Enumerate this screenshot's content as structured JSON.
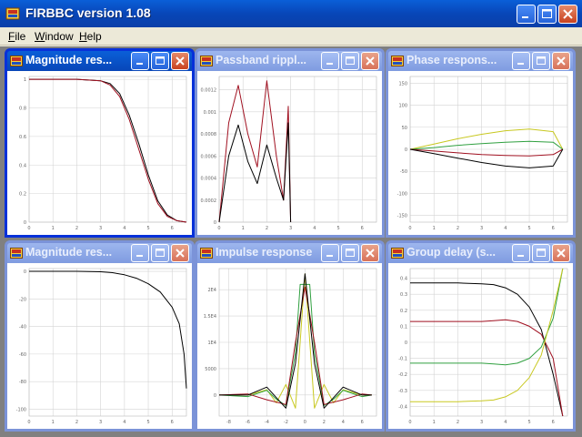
{
  "window": {
    "title": "FIRBBC version 1.08"
  },
  "menu": [
    {
      "label": "File"
    },
    {
      "label": "Window"
    },
    {
      "label": "Help"
    }
  ],
  "colors": {
    "active_title": "#0a3fa8",
    "inactive_title": "#7f9be0",
    "series": [
      "#000000",
      "#a01020",
      "#30a040",
      "#c8c820"
    ]
  },
  "children": [
    {
      "title": "Magnitude res...",
      "active": true
    },
    {
      "title": "Passband rippl...",
      "active": false
    },
    {
      "title": "Phase respons...",
      "active": false
    },
    {
      "title": "Magnitude res...",
      "active": false
    },
    {
      "title": "Impulse response",
      "active": false
    },
    {
      "title": "Group delay (s...",
      "active": false
    }
  ],
  "chart_data": [
    {
      "type": "line",
      "x_ticks": [
        "0",
        "1",
        "2",
        "3",
        "4",
        "5",
        "6"
      ],
      "y_ticks": [
        "0",
        "0.2",
        "0.4",
        "0.6",
        "0.8",
        "1"
      ],
      "xlim": [
        0,
        6.6
      ],
      "ylim": [
        0,
        1.02
      ],
      "series": [
        {
          "color": "#000000",
          "x": [
            0,
            1,
            2,
            3,
            3.4,
            3.8,
            4.2,
            4.6,
            5.0,
            5.4,
            5.8,
            6.2,
            6.6
          ],
          "y": [
            1,
            1,
            1,
            0.99,
            0.97,
            0.9,
            0.75,
            0.55,
            0.33,
            0.15,
            0.05,
            0.01,
            0
          ]
        },
        {
          "color": "#a01020",
          "x": [
            0,
            1,
            2,
            3,
            3.4,
            3.8,
            4.2,
            4.6,
            5.0,
            5.4,
            5.8,
            6.2,
            6.6
          ],
          "y": [
            1,
            1,
            1,
            0.99,
            0.96,
            0.88,
            0.72,
            0.51,
            0.3,
            0.13,
            0.04,
            0.01,
            0
          ]
        }
      ]
    },
    {
      "type": "line",
      "x_ticks": [
        "0",
        "1",
        "2",
        "3",
        "4",
        "5",
        "6"
      ],
      "y_ticks": [
        "0",
        "0.0002",
        "0.0004",
        "0.0006",
        "0.0008",
        "0.001",
        "0.0012"
      ],
      "xlim": [
        0,
        6.6
      ],
      "ylim": [
        0,
        0.00132
      ],
      "series": [
        {
          "color": "#a01020",
          "x": [
            0,
            0.4,
            0.8,
            1.2,
            1.6,
            2.0,
            2.4,
            2.7,
            2.9,
            3.0
          ],
          "y": [
            0,
            0.0009,
            0.00124,
            0.0008,
            0.0005,
            0.00128,
            0.0006,
            0.0002,
            0.00105,
            0
          ]
        },
        {
          "color": "#000000",
          "x": [
            0,
            0.4,
            0.8,
            1.2,
            1.6,
            2.0,
            2.4,
            2.7,
            2.9,
            3.0
          ],
          "y": [
            0,
            0.0006,
            0.00088,
            0.00055,
            0.00035,
            0.0007,
            0.0004,
            0.0002,
            0.0009,
            0
          ]
        }
      ]
    },
    {
      "type": "line",
      "x_ticks": [
        "0",
        "1",
        "2",
        "3",
        "4",
        "5",
        "6"
      ],
      "y_ticks": [
        "-150",
        "-100",
        "-50",
        "0",
        "50",
        "100",
        "150"
      ],
      "xlim": [
        0,
        6.6
      ],
      "ylim": [
        -165,
        165
      ],
      "series": [
        {
          "color": "#c8c820",
          "x": [
            0,
            1,
            2,
            3,
            4,
            5,
            6,
            6.4
          ],
          "y": [
            0,
            12,
            24,
            34,
            42,
            46,
            40,
            0
          ]
        },
        {
          "color": "#30a040",
          "x": [
            0,
            1,
            2,
            3,
            4,
            5,
            6,
            6.4
          ],
          "y": [
            0,
            4,
            9,
            13,
            16,
            18,
            16,
            0
          ]
        },
        {
          "color": "#a01020",
          "x": [
            0,
            1,
            2,
            3,
            4,
            5,
            6,
            6.4
          ],
          "y": [
            0,
            -4,
            -8,
            -12,
            -14,
            -15,
            -12,
            0
          ]
        },
        {
          "color": "#000000",
          "x": [
            0,
            1,
            2,
            3,
            4,
            5,
            6,
            6.4
          ],
          "y": [
            0,
            -10,
            -20,
            -30,
            -38,
            -42,
            -38,
            0
          ]
        }
      ]
    },
    {
      "type": "line",
      "x_ticks": [
        "0",
        "1",
        "2",
        "3",
        "4",
        "5",
        "6"
      ],
      "y_ticks": [
        "-100",
        "-80",
        "-60",
        "-40",
        "-20",
        "0"
      ],
      "xlim": [
        0,
        6.6
      ],
      "ylim": [
        -105,
        2
      ],
      "series": [
        {
          "color": "#000000",
          "x": [
            0,
            1,
            2,
            3,
            3.5,
            4,
            4.5,
            5,
            5.5,
            6,
            6.3,
            6.5,
            6.6
          ],
          "y": [
            0,
            0,
            0,
            -0.3,
            -1,
            -2.5,
            -5,
            -9,
            -15,
            -26,
            -38,
            -60,
            -85
          ]
        }
      ]
    },
    {
      "type": "line",
      "x_ticks": [
        "-8",
        "-6",
        "-4",
        "-2",
        "0",
        "2",
        "4",
        "6"
      ],
      "y_ticks": [
        "0",
        "5000",
        "1E4",
        "1.5E4",
        "2E4"
      ],
      "xlim": [
        -9,
        7.5
      ],
      "ylim": [
        -4000,
        24000
      ],
      "series": [
        {
          "color": "#c8c820",
          "x": [
            -9,
            -6,
            -4,
            -3,
            -2,
            -1,
            0,
            1,
            2,
            3,
            4,
            6,
            7
          ],
          "y": [
            0,
            0,
            1000,
            -1500,
            2000,
            -2500,
            23000,
            -2500,
            2000,
            -1500,
            1000,
            0,
            0
          ]
        },
        {
          "color": "#30a040",
          "x": [
            -9,
            -6,
            -4,
            -3,
            -2,
            -1,
            -0.5,
            0.5,
            1,
            2,
            3,
            4,
            6,
            7
          ],
          "y": [
            0,
            -300,
            900,
            -800,
            -2000,
            8000,
            21000,
            21000,
            8000,
            -2000,
            -800,
            900,
            -300,
            0
          ]
        },
        {
          "color": "#a01020",
          "x": [
            -9,
            -6,
            -4,
            -2,
            -1,
            0,
            1,
            2,
            4,
            6,
            7
          ],
          "y": [
            0,
            200,
            -900,
            -1800,
            10000,
            20500,
            10000,
            -1800,
            -900,
            200,
            0
          ]
        },
        {
          "color": "#000000",
          "x": [
            -9,
            -6,
            -4,
            -2,
            -1,
            0,
            1,
            2,
            4,
            6,
            7
          ],
          "y": [
            0,
            0,
            1500,
            -2500,
            6000,
            23000,
            6000,
            -2500,
            1500,
            0,
            0
          ]
        }
      ]
    },
    {
      "type": "line",
      "x_ticks": [
        "0",
        "1",
        "2",
        "3",
        "4",
        "5",
        "6"
      ],
      "y_ticks": [
        "-0.4",
        "-0.3",
        "-0.2",
        "-0.1",
        "0",
        "0.1",
        "0.2",
        "0.3",
        "0.4"
      ],
      "xlim": [
        0,
        6.6
      ],
      "ylim": [
        -0.46,
        0.46
      ],
      "series": [
        {
          "color": "#000000",
          "x": [
            0,
            1,
            2,
            3,
            3.5,
            4,
            4.5,
            5,
            5.5,
            6,
            6.4
          ],
          "y": [
            0.37,
            0.37,
            0.37,
            0.365,
            0.36,
            0.34,
            0.3,
            0.22,
            0.08,
            -0.2,
            -0.46
          ]
        },
        {
          "color": "#a01020",
          "x": [
            0,
            1,
            2,
            3,
            3.5,
            4,
            4.5,
            5,
            5.5,
            6,
            6.4
          ],
          "y": [
            0.13,
            0.13,
            0.13,
            0.13,
            0.135,
            0.14,
            0.13,
            0.1,
            0.05,
            -0.1,
            -0.46
          ]
        },
        {
          "color": "#30a040",
          "x": [
            0,
            1,
            2,
            3,
            3.5,
            4,
            4.5,
            5,
            5.5,
            6,
            6.4
          ],
          "y": [
            -0.13,
            -0.13,
            -0.13,
            -0.13,
            -0.135,
            -0.14,
            -0.13,
            -0.1,
            -0.03,
            0.15,
            0.46
          ]
        },
        {
          "color": "#c8c820",
          "x": [
            0,
            1,
            2,
            3,
            3.5,
            4,
            4.5,
            5,
            5.5,
            6,
            6.4
          ],
          "y": [
            -0.37,
            -0.37,
            -0.37,
            -0.365,
            -0.36,
            -0.34,
            -0.3,
            -0.22,
            -0.08,
            0.2,
            0.46
          ]
        }
      ]
    }
  ]
}
